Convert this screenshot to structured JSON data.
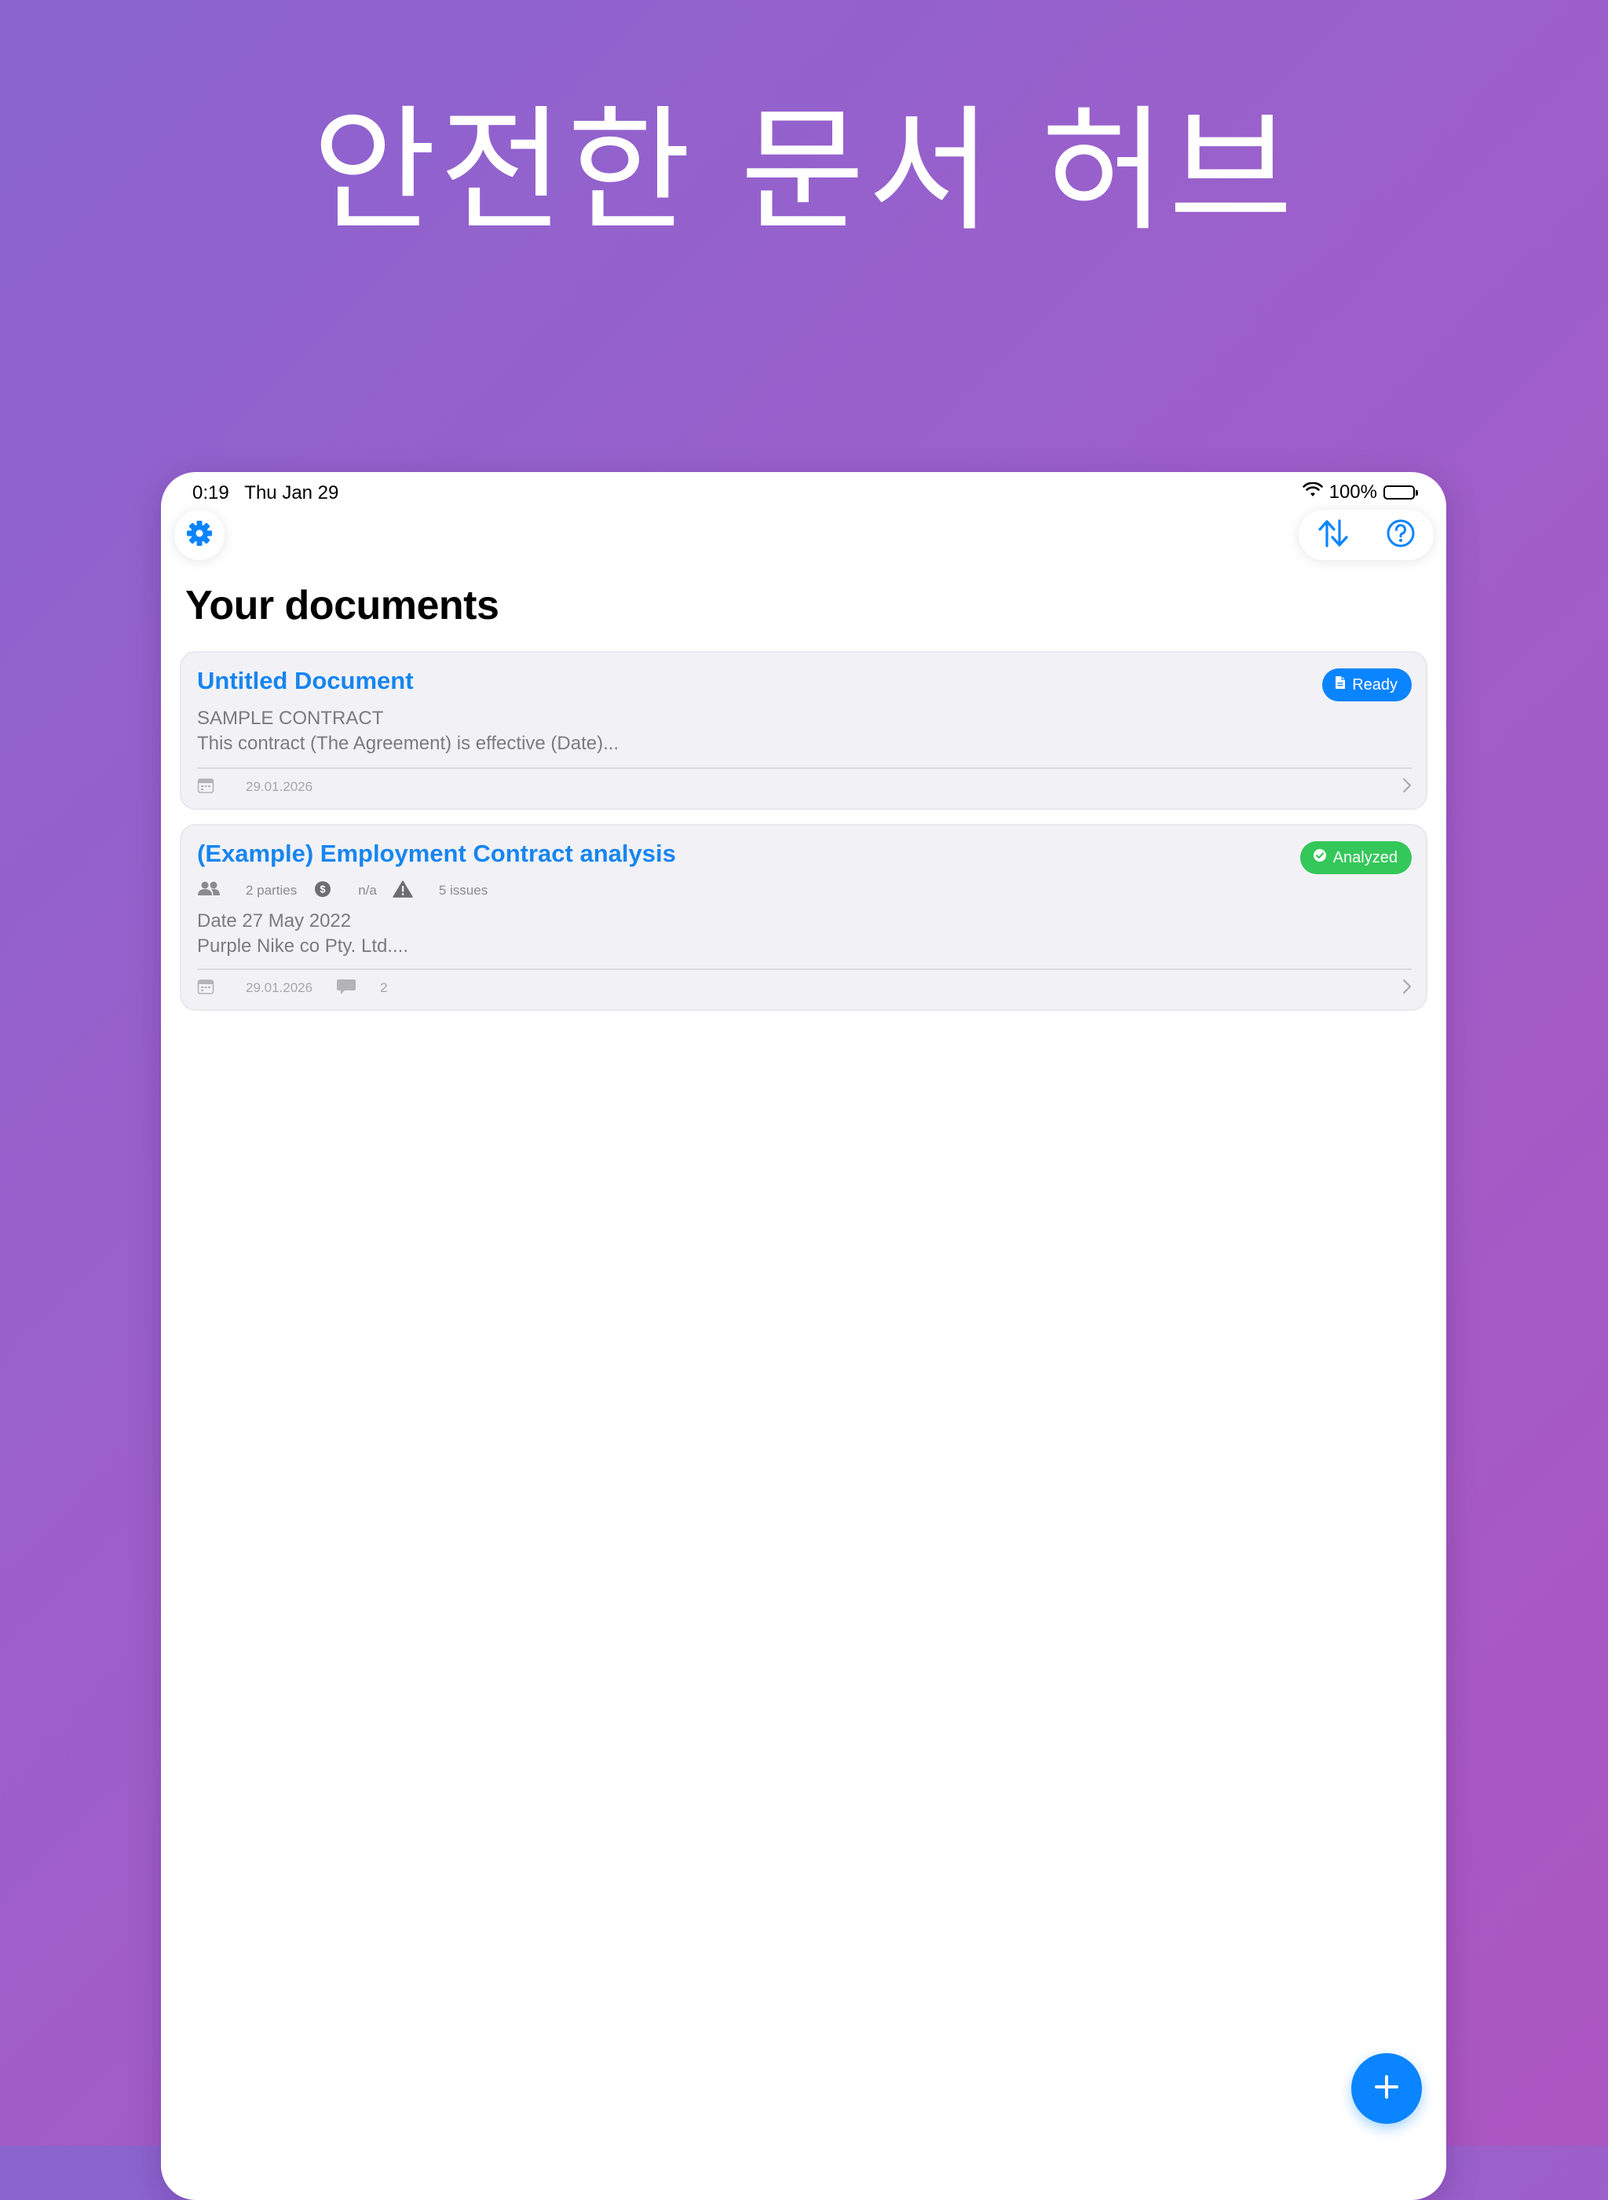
{
  "headline": "안전한 문서 허브",
  "status_bar": {
    "time": "0:19",
    "date": "Thu Jan 29",
    "battery": "100%"
  },
  "page_title": "Your documents",
  "documents": [
    {
      "title": "Untitled Document",
      "status": "Ready",
      "preview_line1": "SAMPLE CONTRACT",
      "preview_line2": "This contract (The Agreement) is effective (Date)...",
      "date": "29.01.2026"
    },
    {
      "title": "(Example) Employment Contract analysis",
      "status": "Analyzed",
      "parties": "2 parties",
      "value": "n/a",
      "issues": "5 issues",
      "preview_line1": "Date 27 May 2022",
      "preview_line2": "Purple Nike co Pty. Ltd....",
      "date": "29.01.2026",
      "comments": "2"
    }
  ],
  "colors": {
    "accent": "#0a84ff",
    "title_blue": "#1785f0",
    "analyzed_green": "#34c759",
    "card_bg": "#f2f2f6",
    "background_start": "#8a64cf",
    "background_end": "#ac56c1"
  },
  "icons": [
    "wifi-icon",
    "battery-icon",
    "gear-icon",
    "sort-arrows-icon",
    "help-icon",
    "document-icon",
    "checkmark-circle-icon",
    "calendar-icon",
    "people-icon",
    "dollar-circle-icon",
    "warning-icon",
    "comment-icon",
    "chevron-right-icon",
    "plus-icon"
  ]
}
